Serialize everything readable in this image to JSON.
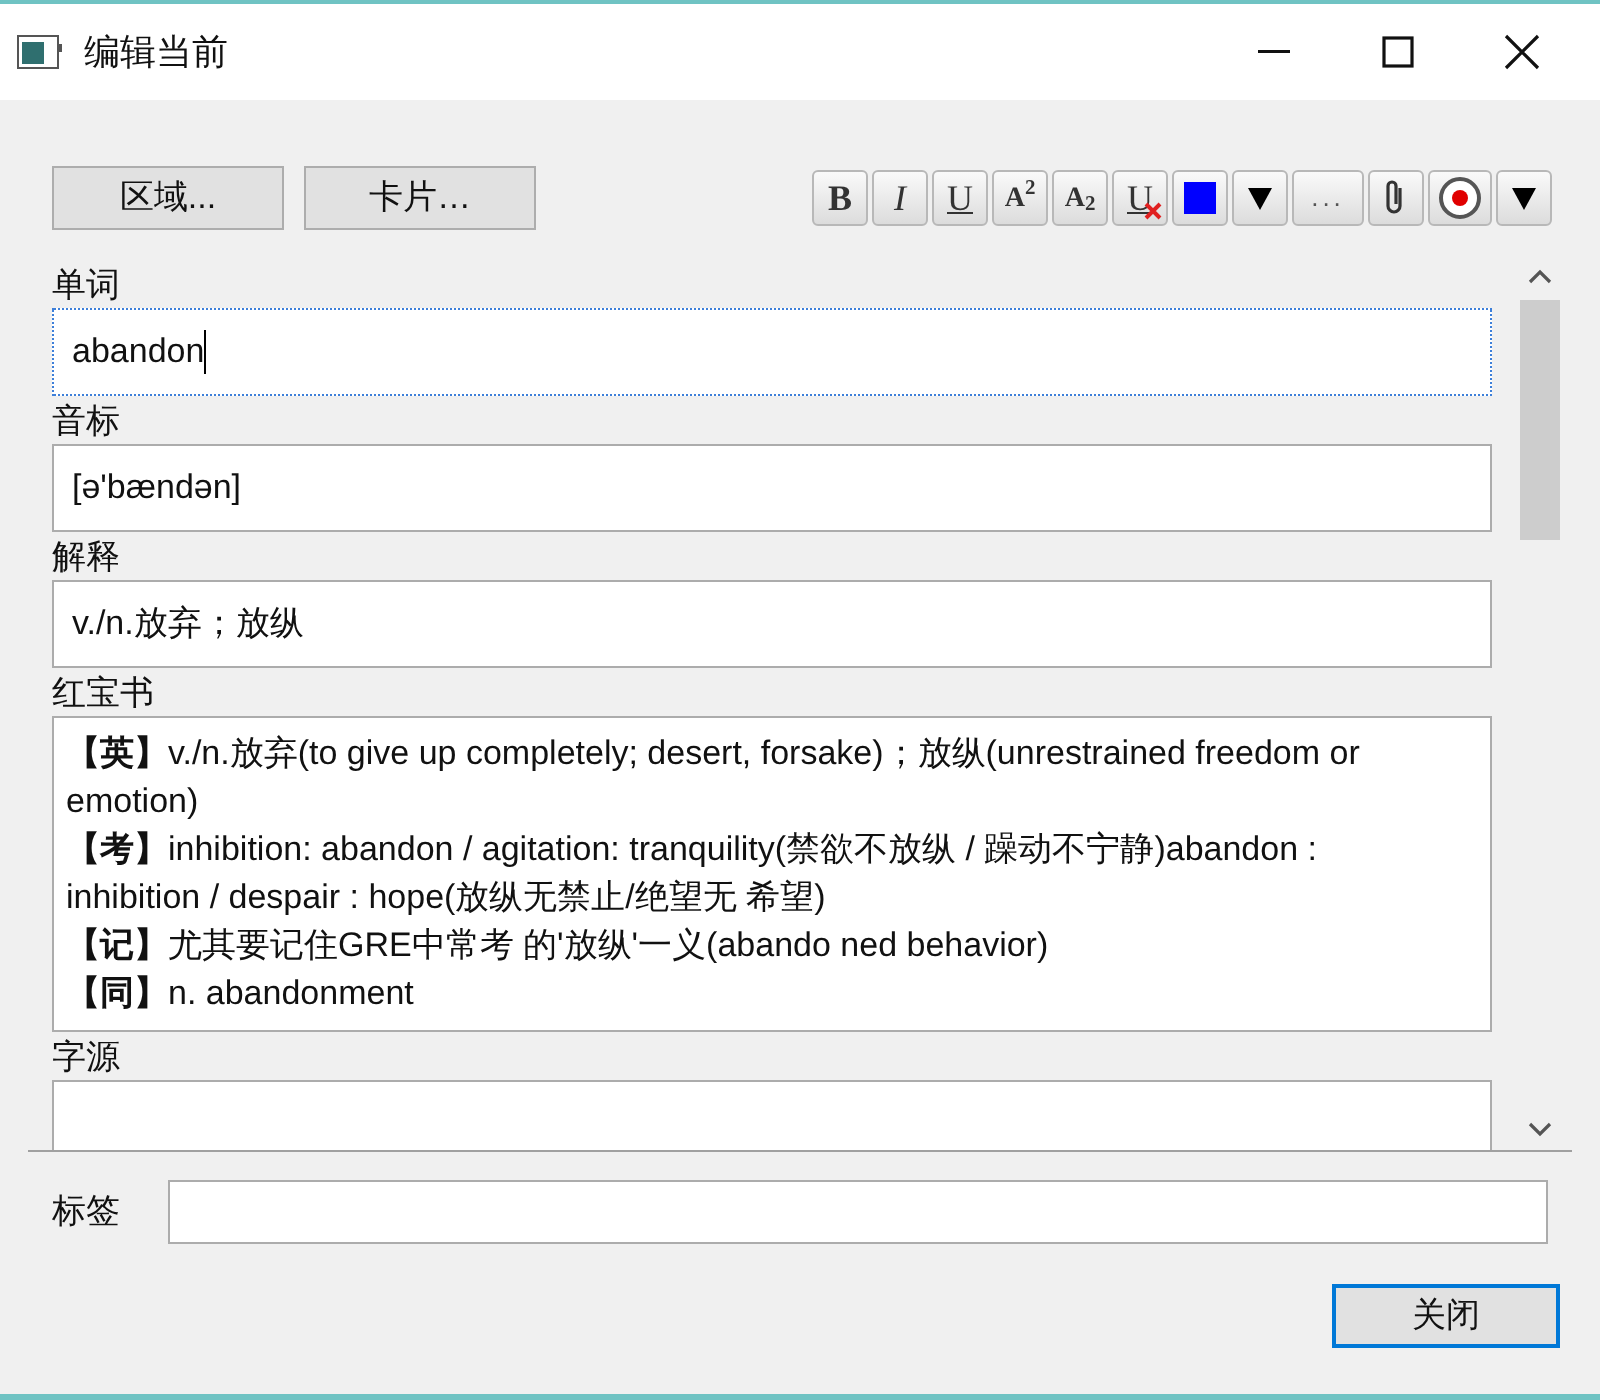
{
  "window": {
    "title": "编辑当前"
  },
  "top_buttons": [
    {
      "label": "区域..."
    },
    {
      "label": "卡片…"
    }
  ],
  "format_toolbar": [
    {
      "kind": "bold",
      "label": "B"
    },
    {
      "kind": "italic",
      "label": "I"
    },
    {
      "kind": "underline",
      "label": "U"
    },
    {
      "kind": "superscript",
      "label": "A$^{2}$"
    },
    {
      "kind": "subscript",
      "label": "A$_{2}$"
    },
    {
      "kind": "clear",
      "label": "U"
    },
    {
      "kind": "color",
      "color": "#0000ff"
    },
    {
      "kind": "dropdown"
    },
    {
      "kind": "more",
      "label": "..."
    },
    {
      "kind": "attach"
    },
    {
      "kind": "record"
    },
    {
      "kind": "dropdown"
    }
  ],
  "fields": [
    {
      "kind": "line",
      "label": "单词",
      "value": "abandon",
      "focused": true
    },
    {
      "kind": "line",
      "label": "音标",
      "value": "[ə'bændən]",
      "focused": false
    },
    {
      "kind": "line",
      "label": "解释",
      "value": "v./n.放弃；放纵",
      "focused": false
    },
    {
      "kind": "rich",
      "label": "红宝书",
      "focused": false,
      "paragraphs": [
        "**【英】**v./n.放弃(to give up completely; desert, forsake)；放纵(unrestrained freedom or emotion)",
        "**【考】**inhibition: abandon / agitation: tranquility(禁欲不放纵 / 躁动不宁静)abandon : inhibition / despair : hope(放纵无禁止/绝望无 希望)",
        "**【记】**尤其要记住GRE中常考 的'放纵'一义(abando ned behavior)",
        "**【同】**n. abandonment"
      ]
    },
    {
      "kind": "cut",
      "label": "字源",
      "focused": false
    }
  ],
  "tags": {
    "label": "标签"
  },
  "close_button": {
    "label": "关闭"
  }
}
